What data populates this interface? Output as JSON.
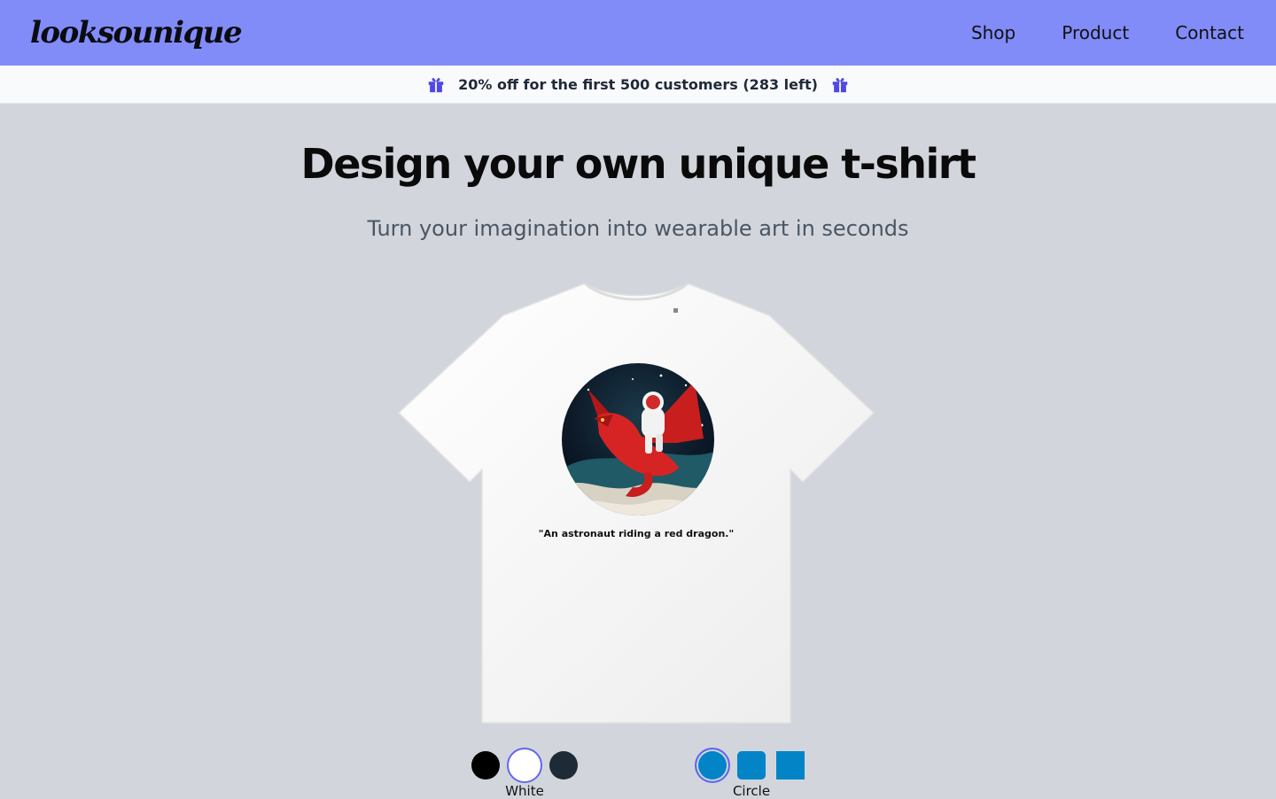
{
  "brand": {
    "logo": "looksounique"
  },
  "nav": {
    "items": [
      "Shop",
      "Product",
      "Contact"
    ]
  },
  "promo": {
    "text": "20% off for the first 500 customers (283 left)",
    "accent": "#4f46e5"
  },
  "hero": {
    "title": "Design your own unique t-shirt",
    "subtitle": "Turn your imagination into wearable art in seconds"
  },
  "product": {
    "caption": "\"An astronaut riding a red dragon.\"",
    "shirt_color": "#f4f4f4"
  },
  "colors": {
    "options": [
      {
        "name": "Black",
        "hex": "#000000"
      },
      {
        "name": "White",
        "hex": "#ffffff"
      },
      {
        "name": "Navy",
        "hex": "#1e2a36"
      }
    ],
    "selected_label": "White"
  },
  "shapes": {
    "options": [
      "circle",
      "rounded-square",
      "square"
    ],
    "selected_label": "Circle",
    "accent": "#0284c7"
  }
}
